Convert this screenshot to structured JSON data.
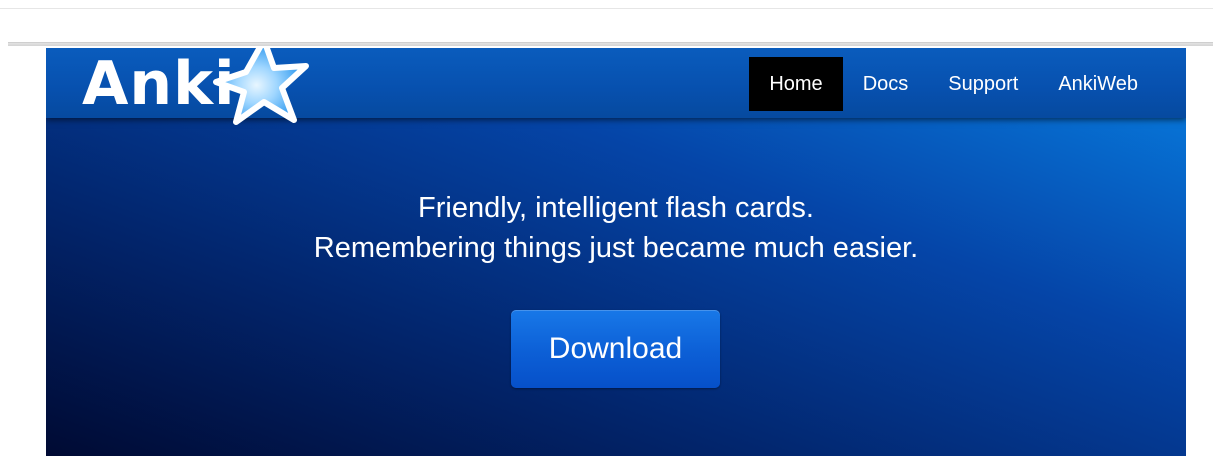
{
  "logo": {
    "text": "Anki"
  },
  "nav": {
    "items": [
      {
        "label": "Home",
        "active": true
      },
      {
        "label": "Docs",
        "active": false
      },
      {
        "label": "Support",
        "active": false
      },
      {
        "label": "AnkiWeb",
        "active": false
      }
    ]
  },
  "hero": {
    "tagline_line1": "Friendly, intelligent flash cards.",
    "tagline_line2": "Remembering things just became much easier.",
    "download_label": "Download"
  },
  "colors": {
    "navbar": "#0750ae",
    "active_nav": "#000000",
    "button": "#0c5fd6",
    "hero_dark": "#000a33",
    "hero_light": "#0773d6"
  },
  "icons": {
    "logo_star": "star-icon"
  }
}
